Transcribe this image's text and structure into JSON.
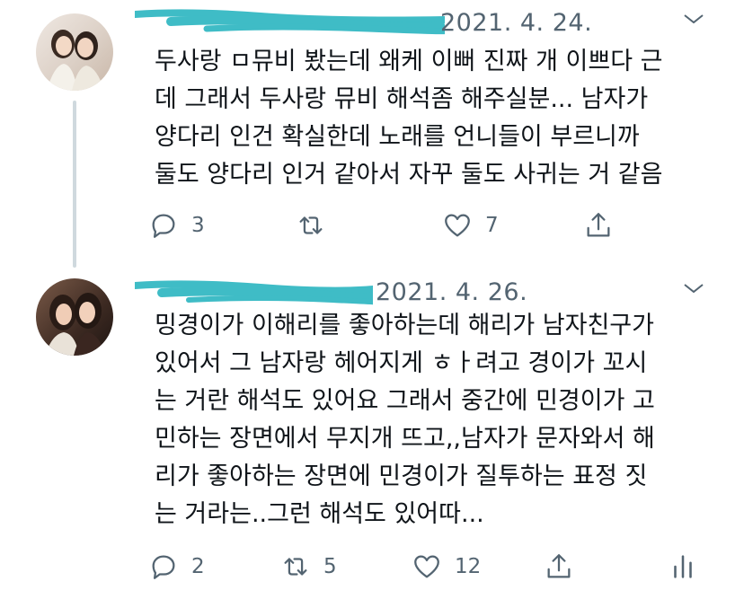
{
  "tweets": [
    {
      "date": "2021. 4. 24.",
      "text": "두사랑 ㅁ뮤비 봤는데 왜케 이뻐 진짜 개 이쁘다 근\n데 그래서 두사랑 뮤비 해석좀 해주실분... 남자가\n양다리 인건 확실한데 노래를 언니들이 부르니까\n둘도 양다리 인거 같아서 자꾸 둘도 사귀는 거 같음",
      "actions": {
        "reply_count": "3",
        "retweet_count": "",
        "like_count": "7"
      }
    },
    {
      "date": "2021. 4. 26.",
      "text": "밍경이가 이해리를 좋아하는데 해리가 남자친구가\n있어서 그 남자랑 헤어지게 ㅎㅏ려고 경이가 꼬시\n는 거란 해석도 있어요 그래서 중간에 민경이가 고\n민하는 장면에서 무지개 뜨고,,남자가 문자와서 해\n리가 좋아하는 장면에 민경이가 질투하는 표정 짓\n는 거라는..그런 해석도 있어따...",
      "actions": {
        "reply_count": "2",
        "retweet_count": "5",
        "like_count": "12"
      }
    }
  ],
  "icons": {
    "reply": "reply-icon",
    "retweet": "retweet-icon",
    "like": "heart-icon",
    "share": "share-icon",
    "analytics": "analytics-icon",
    "more": "chevron-down-icon"
  },
  "colors": {
    "text": "#0f1419",
    "muted": "#536471",
    "scribble": "#3fbcc6",
    "thread_line": "#cfd9de"
  }
}
